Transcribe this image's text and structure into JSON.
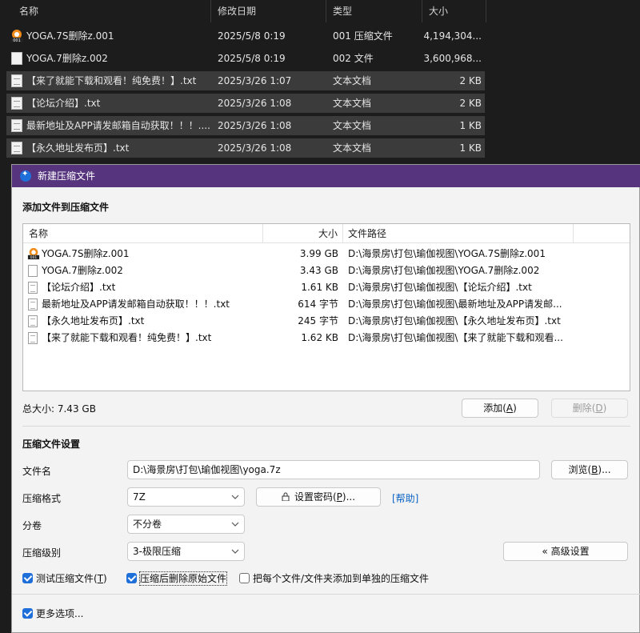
{
  "explorer": {
    "columns": [
      "名称",
      "修改日期",
      "类型",
      "大小"
    ],
    "rows": [
      {
        "icon": "7z-archive-icon",
        "name": "YOGA.7S删除z.001",
        "date": "2025/5/8 0:19",
        "type": "001 压缩文件",
        "size": "4,194,304...",
        "selected": false
      },
      {
        "icon": "document-icon",
        "name": "YOGA.7删除z.002",
        "date": "2025/5/8 0:19",
        "type": "002 文件",
        "size": "3,600,968...",
        "selected": false
      },
      {
        "icon": "text-document-icon",
        "name": "【来了就能下载和观看！纯免费！】.txt",
        "date": "2025/3/26 1:07",
        "type": "文本文档",
        "size": "2 KB",
        "selected": true
      },
      {
        "icon": "text-document-icon",
        "name": "【论坛介绍】.txt",
        "date": "2025/3/26 1:08",
        "type": "文本文档",
        "size": "2 KB",
        "selected": true
      },
      {
        "icon": "text-document-icon",
        "name": "最新地址及APP请发邮箱自动获取！！！....",
        "date": "2025/3/26 1:08",
        "type": "文本文档",
        "size": "1 KB",
        "selected": true
      },
      {
        "icon": "text-document-icon",
        "name": "【永久地址发布页】.txt",
        "date": "2025/3/26 1:08",
        "type": "文本文档",
        "size": "1 KB",
        "selected": true
      }
    ]
  },
  "dialog": {
    "title": "新建压缩文件",
    "add_section_label": "添加文件到压缩文件",
    "list_columns": {
      "name": "名称",
      "size": "大小",
      "path": "文件路径"
    },
    "files": [
      {
        "icon": "7z-archive-icon",
        "name": "YOGA.7S删除z.001",
        "size": "3.99 GB",
        "path": "D:\\海景房\\打包\\瑜伽视图\\YOGA.7S删除z.001"
      },
      {
        "icon": "document-icon",
        "name": "YOGA.7删除z.002",
        "size": "3.43 GB",
        "path": "D:\\海景房\\打包\\瑜伽视图\\YOGA.7删除z.002"
      },
      {
        "icon": "text-document-icon",
        "name": "【论坛介绍】.txt",
        "size": "1.61 KB",
        "path": "D:\\海景房\\打包\\瑜伽视图\\【论坛介绍】.txt"
      },
      {
        "icon": "text-document-icon",
        "name": "最新地址及APP请发邮箱自动获取！！！.txt",
        "size": "614 字节",
        "path": "D:\\海景房\\打包\\瑜伽视图\\最新地址及APP请发邮..."
      },
      {
        "icon": "text-document-icon",
        "name": "【永久地址发布页】.txt",
        "size": "245 字节",
        "path": "D:\\海景房\\打包\\瑜伽视图\\【永久地址发布页】.txt"
      },
      {
        "icon": "text-document-icon",
        "name": "【来了就能下载和观看！纯免费！】.txt",
        "size": "1.62 KB",
        "path": "D:\\海景房\\打包\\瑜伽视图\\【来了就能下载和观看..."
      }
    ],
    "total_size": "总大小: 7.43 GB",
    "add_button": "添加",
    "add_button_key": "A",
    "remove_button": "删除",
    "remove_button_key": "D",
    "settings_label": "压缩文件设置",
    "filename_label": "文件名",
    "filename_value": "D:\\海景房\\打包\\瑜伽视图\\yoga.7z",
    "browse_button": "浏览",
    "browse_button_key": "B",
    "format_label": "压缩格式",
    "format_value": "7Z",
    "password_button": "设置密码",
    "password_button_key": "P",
    "help_link": "[帮助]",
    "volume_label": "分卷",
    "volume_value": "不分卷",
    "level_label": "压缩级别",
    "level_value": "3-极限压缩",
    "advanced_button": "« 高级设置",
    "options": {
      "test": {
        "label": "测试压缩文件",
        "key": "T",
        "checked": true
      },
      "delete_after": {
        "label": "压缩后删除原始文件",
        "checked": true
      },
      "separate": {
        "label": "把每个文件/文件夹添加到单独的压缩文件",
        "checked": false
      },
      "more": {
        "label": "更多选项...",
        "checked": true
      }
    }
  },
  "colors": {
    "titlebar": "#56357e",
    "accent": "#1e6fd9",
    "link": "#0a63c4",
    "explorer_bg": "#1c1c1c",
    "dialog_bg": "#f3f3f3"
  }
}
